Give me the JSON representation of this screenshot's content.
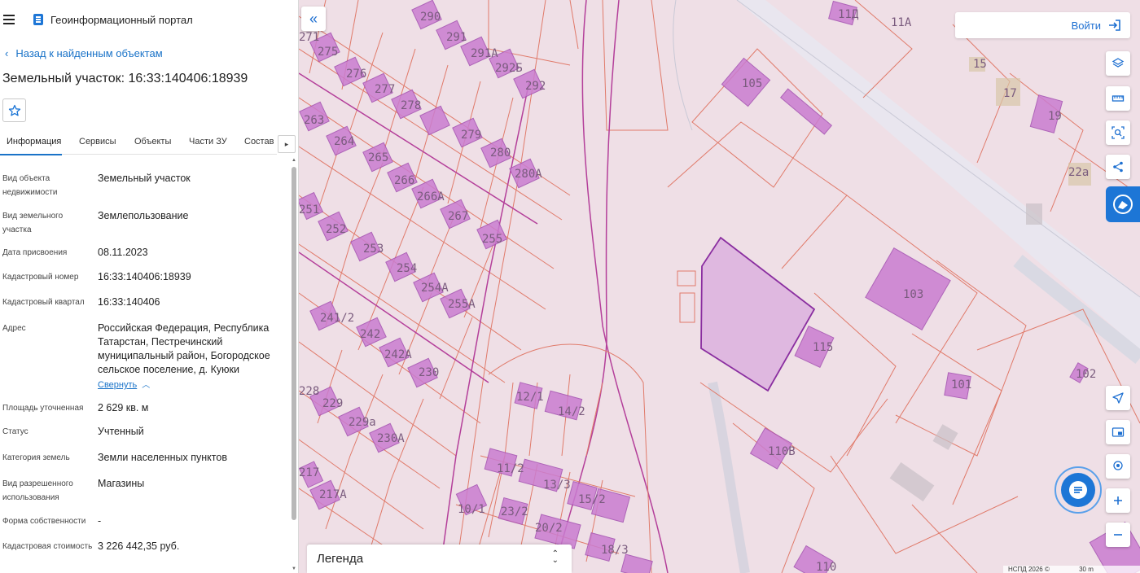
{
  "app": {
    "title": "Геоинформационный портал"
  },
  "nav": {
    "back_label": "Назад к найденным объектам"
  },
  "object": {
    "title": "Земельный участок: 16:33:140406:18939"
  },
  "tabs": [
    {
      "label": "Информация"
    },
    {
      "label": "Сервисы"
    },
    {
      "label": "Объекты"
    },
    {
      "label": "Части ЗУ"
    },
    {
      "label": "Состав"
    }
  ],
  "info": [
    {
      "label": "Вид объекта недвижимости",
      "value": "Земельный участок"
    },
    {
      "label": "Вид земельного участка",
      "value": "Землепользование"
    },
    {
      "label": "Дата присвоения",
      "value": "08.11.2023"
    },
    {
      "label": "Кадастровый номер",
      "value": "16:33:140406:18939"
    },
    {
      "label": "Кадастровый квартал",
      "value": "16:33:140406"
    },
    {
      "label": "Адрес",
      "value": "Российская Федерация, Республика Татарстан, Пестречинский муниципальный район, Богородское сельское поселение, д. Куюки"
    },
    {
      "label": "Площадь уточненная",
      "value": "2 629 кв. м"
    },
    {
      "label": "Статус",
      "value": "Учтенный"
    },
    {
      "label": "Категория земель",
      "value": "Земли населенных пунктов"
    },
    {
      "label": "Вид разрешенного использования",
      "value": "Магазины"
    },
    {
      "label": "Форма собственности",
      "value": "-"
    },
    {
      "label": "Кадастровая стоимость",
      "value": "3 226 442,35 руб."
    }
  ],
  "address_toggle": "Свернуть",
  "map": {
    "login_label": "Войти",
    "legend_label": "Легенда",
    "copyright": "НСПД 2026 ©",
    "scale": "30 m",
    "parcel_labels": [
      "290",
      "291",
      "275",
      "276",
      "291А",
      "292Б",
      "277",
      "292",
      "278",
      "263",
      "279",
      "264",
      "280",
      "265",
      "280А",
      "266",
      "266А",
      "267",
      "251",
      "252",
      "255",
      "253",
      "254",
      "254А",
      "255А",
      "241/2",
      "242",
      "242А",
      "230",
      "229",
      "229а",
      "230А",
      "217",
      "217А",
      "12/1",
      "14/2",
      "11/2",
      "13/3",
      "15/2",
      "10/1",
      "23/2",
      "20/2",
      "18/3",
      "105",
      "103",
      "115",
      "101",
      "102",
      "110В",
      "110",
      "19",
      "22а",
      "17",
      "15",
      "11А",
      "11Д",
      "271",
      "228"
    ]
  },
  "colors": {
    "accent": "#1d76d6",
    "parcel_line": "#e07a6a",
    "highlight": "#8a2ea0",
    "building": "#c97cd0"
  }
}
